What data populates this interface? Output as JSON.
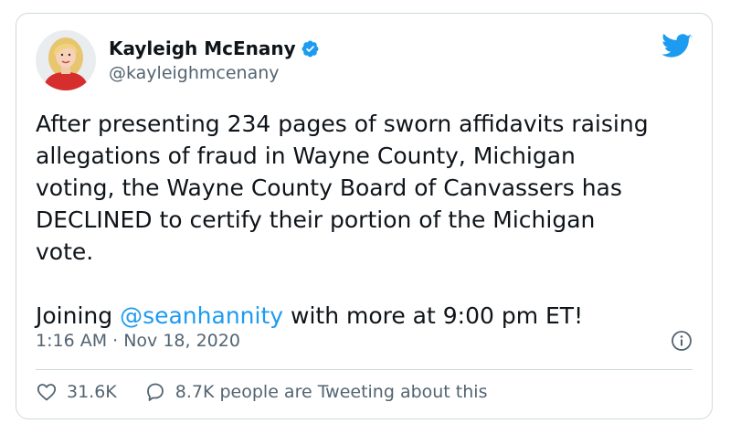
{
  "tweet": {
    "author": {
      "display_name": "Kayleigh McEnany",
      "handle": "@kayleighmcenany",
      "verified": true
    },
    "text_parts": [
      "After presenting 234 pages of sworn affidavits raising\nallegations of fraud in Wayne County, Michigan\nvoting, the Wayne County Board of Canvassers has\nDECLINED to certify their portion of the Michigan\nvote.\n\nJoining ",
      "@seanhannity",
      " with more at 9:00 pm ET!"
    ],
    "timestamp": "1:16 AM · Nov 18, 2020",
    "likes": "31.6K",
    "conversation": "8.7K people are Tweeting about this"
  },
  "icons": {
    "verified": "verified-badge-icon",
    "brand": "twitter-bird-icon",
    "info": "info-icon",
    "like": "heart-icon",
    "reply": "speech-bubble-icon"
  },
  "colors": {
    "accent": "#1d9bf0",
    "text": "#0f1419",
    "secondary": "#536471",
    "border": "#cfd9de",
    "avatar_shirt": "#d62d2d"
  }
}
